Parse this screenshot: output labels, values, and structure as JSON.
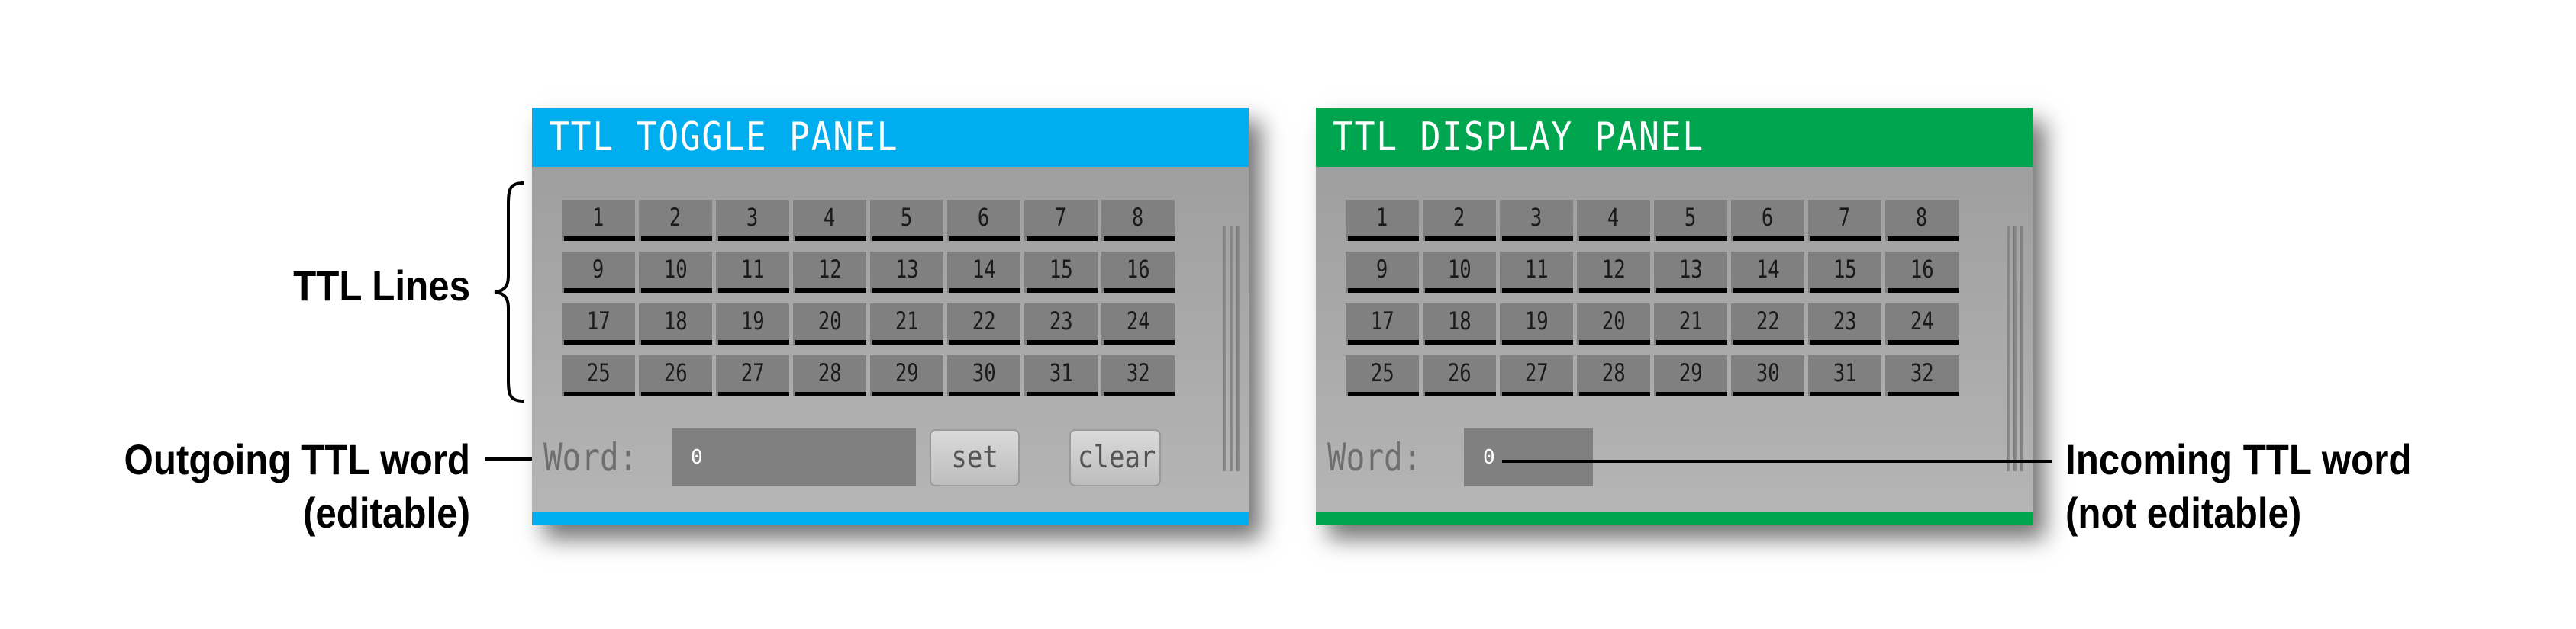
{
  "colors": {
    "toggle_accent": "#00adee",
    "display_accent": "#00a550",
    "ttl_line_indicator": "#000000"
  },
  "annotations": {
    "ttl_lines": "TTL Lines",
    "outgoing": [
      "Outgoing TTL word",
      "(editable)"
    ],
    "incoming": [
      "Incoming TTL word",
      "(not editable)"
    ]
  },
  "toggle_panel": {
    "title": "TTL TOGGLE PANEL",
    "lines": [
      "1",
      "2",
      "3",
      "4",
      "5",
      "6",
      "7",
      "8",
      "9",
      "10",
      "11",
      "12",
      "13",
      "14",
      "15",
      "16",
      "17",
      "18",
      "19",
      "20",
      "21",
      "22",
      "23",
      "24",
      "25",
      "26",
      "27",
      "28",
      "29",
      "30",
      "31",
      "32"
    ],
    "word_label": "Word:",
    "word_value": "0",
    "set_label": "set",
    "clear_label": "clear"
  },
  "display_panel": {
    "title": "TTL DISPLAY PANEL",
    "lines": [
      "1",
      "2",
      "3",
      "4",
      "5",
      "6",
      "7",
      "8",
      "9",
      "10",
      "11",
      "12",
      "13",
      "14",
      "15",
      "16",
      "17",
      "18",
      "19",
      "20",
      "21",
      "22",
      "23",
      "24",
      "25",
      "26",
      "27",
      "28",
      "29",
      "30",
      "31",
      "32"
    ],
    "word_label": "Word:",
    "word_value": "0"
  }
}
